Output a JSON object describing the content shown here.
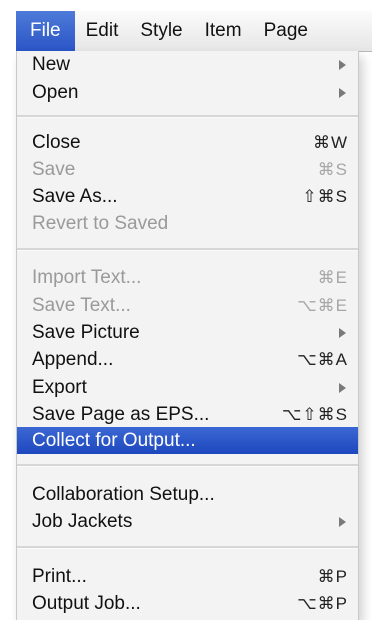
{
  "menubar": {
    "items": [
      "File",
      "Edit",
      "Style",
      "Item",
      "Page"
    ]
  },
  "menu": {
    "items": [
      {
        "label": "New",
        "shortcut": "",
        "submenu": true,
        "disabled": false
      },
      {
        "label": "Open",
        "shortcut": "",
        "submenu": true,
        "disabled": false
      },
      {
        "label": "Close",
        "shortcut": "⌘W",
        "submenu": false,
        "disabled": false
      },
      {
        "label": "Save",
        "shortcut": "⌘S",
        "submenu": false,
        "disabled": true
      },
      {
        "label": "Save As...",
        "shortcut": "⇧⌘S",
        "submenu": false,
        "disabled": false
      },
      {
        "label": "Revert to Saved",
        "shortcut": "",
        "submenu": false,
        "disabled": true
      },
      {
        "label": "Import Text...",
        "shortcut": "⌘E",
        "submenu": false,
        "disabled": true
      },
      {
        "label": "Save Text...",
        "shortcut": "⌥⌘E",
        "submenu": false,
        "disabled": true
      },
      {
        "label": "Save Picture",
        "shortcut": "",
        "submenu": true,
        "disabled": false
      },
      {
        "label": "Append...",
        "shortcut": "⌥⌘A",
        "submenu": false,
        "disabled": false
      },
      {
        "label": "Export",
        "shortcut": "",
        "submenu": true,
        "disabled": false
      },
      {
        "label": "Save Page as EPS...",
        "shortcut": "⌥⇧⌘S",
        "submenu": false,
        "disabled": false
      },
      {
        "label": "Collect for Output...",
        "shortcut": "",
        "submenu": false,
        "disabled": false,
        "highlighted": true
      },
      {
        "label": "Collaboration Setup...",
        "shortcut": "",
        "submenu": false,
        "disabled": false
      },
      {
        "label": "Job Jackets",
        "shortcut": "",
        "submenu": true,
        "disabled": false
      },
      {
        "label": "Print...",
        "shortcut": "⌘P",
        "submenu": false,
        "disabled": false
      },
      {
        "label": "Output Job...",
        "shortcut": "⌥⌘P",
        "submenu": false,
        "disabled": false
      }
    ]
  }
}
